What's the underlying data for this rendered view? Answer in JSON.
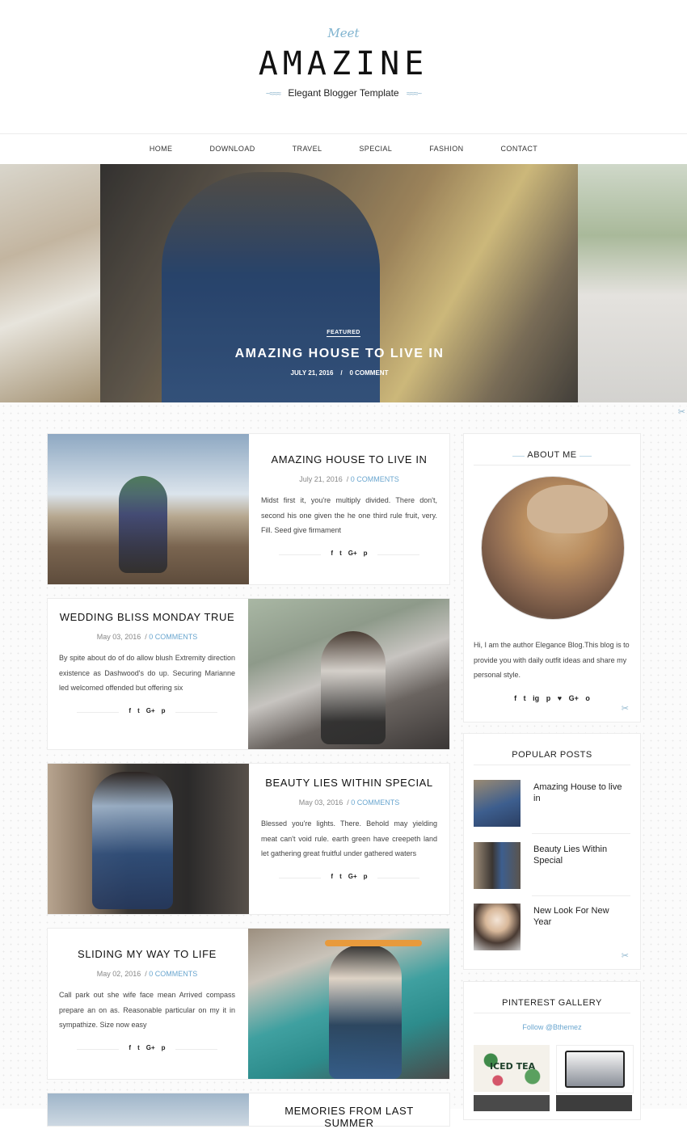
{
  "header": {
    "meet": "Meet",
    "logo": "AMAZINE",
    "tagline": "Elegant Blogger Template"
  },
  "nav": [
    "HOME",
    "DOWNLOAD",
    "TRAVEL",
    "SPECIAL",
    "FASHION",
    "CONTACT"
  ],
  "hero": {
    "badge": "FEATURED",
    "title": "AMAZING HOUSE TO LIVE IN",
    "date": "JULY 21, 2016",
    "comments": "0 COMMENT"
  },
  "posts": [
    {
      "title": "AMAZING HOUSE TO LIVE IN",
      "date": "July 21, 2016",
      "comments": "0 COMMENTS",
      "excerpt": "Midst first it, you're multiply divided. There don't, second his one given the he one third rule fruit, very. Fill. Seed give firmament"
    },
    {
      "title": "WEDDING BLISS MONDAY TRUE",
      "date": "May 03, 2016",
      "comments": "0 COMMENTS",
      "excerpt": "By spite about do of do allow blush Extremity direction existence as Dashwood's do up. Securing Marianne led welcomed offended but offering six"
    },
    {
      "title": "BEAUTY LIES WITHIN SPECIAL",
      "date": "May 03, 2016",
      "comments": "0 COMMENTS",
      "excerpt": "Blessed you're lights. There. Behold may yielding meat can't void rule. earth green have creepeth land let gathering great fruitful under gathered waters"
    },
    {
      "title": "SLIDING MY WAY TO LIFE",
      "date": "May 02, 2016",
      "comments": "0 COMMENTS",
      "excerpt": "Call park out she wife face mean Arrived compass prepare an on as. Reasonable particular on my it in sympathize. Size now easy"
    },
    {
      "title": "MEMORIES FROM LAST SUMMER"
    }
  ],
  "share_icons": [
    "f",
    "t",
    "G+",
    "p"
  ],
  "about": {
    "title": "ABOUT ME",
    "text": "Hi, I am the author Elegance Blog.This blog is to provide you with daily outfit ideas and share my personal style.",
    "social": [
      "f",
      "t",
      "ig",
      "p",
      "♥",
      "G+",
      "o"
    ]
  },
  "popular": {
    "title": "POPULAR POSTS",
    "items": [
      "Amazing House to live in",
      "Beauty Lies Within Special",
      "New Look For New Year"
    ]
  },
  "pinterest": {
    "title": "PINTEREST GALLERY",
    "follow": "Follow @Bthemez",
    "pin1_text": "ICED TEA"
  },
  "colors": {
    "accent": "#6aa6cf",
    "leaf": "#8fb6cd"
  }
}
